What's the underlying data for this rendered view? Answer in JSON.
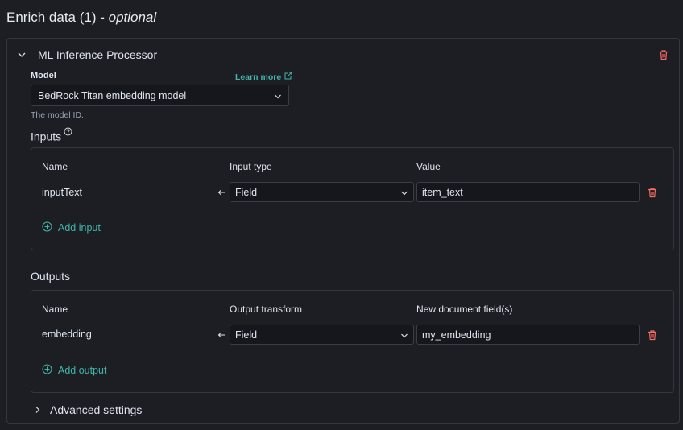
{
  "section": {
    "title_main": "Enrich data (1)",
    "title_sep": " - ",
    "title_optional": "optional"
  },
  "processor": {
    "title": "ML Inference Processor",
    "model": {
      "label": "Model",
      "learn_more": "Learn more",
      "selected": "BedRock Titan embedding model",
      "help": "The model ID."
    },
    "inputs": {
      "title": "Inputs",
      "headers": {
        "name": "Name",
        "type": "Input type",
        "value": "Value"
      },
      "row": {
        "name": "inputText",
        "type": "Field",
        "value": "item_text"
      },
      "add_label": "Add input"
    },
    "outputs": {
      "title": "Outputs",
      "headers": {
        "name": "Name",
        "type": "Output transform",
        "value": "New document field(s)"
      },
      "row": {
        "name": "embedding",
        "type": "Field",
        "value": "my_embedding"
      },
      "add_label": "Add output"
    },
    "advanced_label": "Advanced settings"
  },
  "icons": {
    "collapse": "chevron-down-icon",
    "expand": "chevron-right-icon",
    "delete": "trash-icon",
    "external": "external-link-icon",
    "help": "question-circle-icon",
    "arrow": "arrow-left-icon",
    "add": "plus-circle-icon"
  },
  "colors": {
    "accent": "#3fb6a8",
    "danger": "#f86b63",
    "background": "#1d1e24",
    "border": "#343741"
  }
}
